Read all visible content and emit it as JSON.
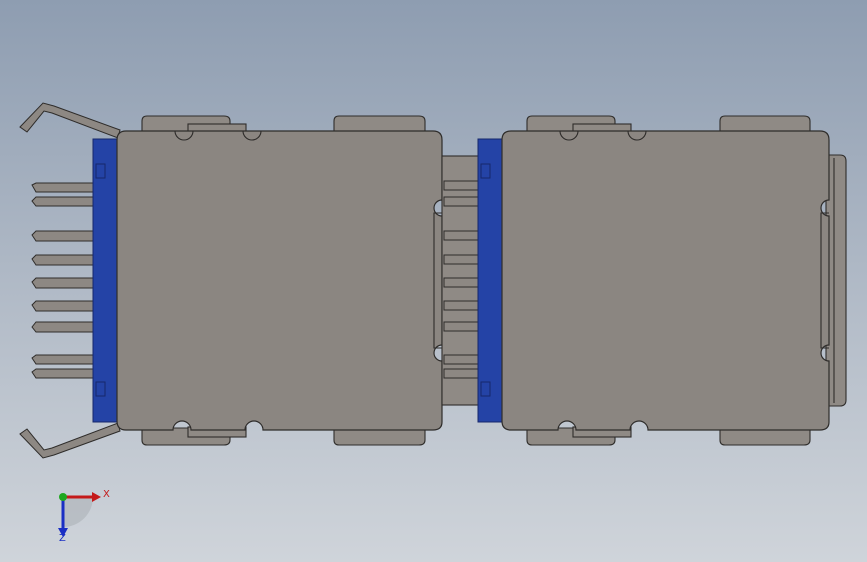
{
  "triad": {
    "x_label": "X",
    "z_label": "Z",
    "colors": {
      "x": "#c41a1a",
      "y": "#1fa81f",
      "z": "#1a2fc4"
    }
  },
  "colors": {
    "background_top": "#8e9db1",
    "background_bottom": "#cfd4da",
    "housing": "#8b8681",
    "insulator": "#2443a6",
    "edge": "#2e2c2a"
  }
}
